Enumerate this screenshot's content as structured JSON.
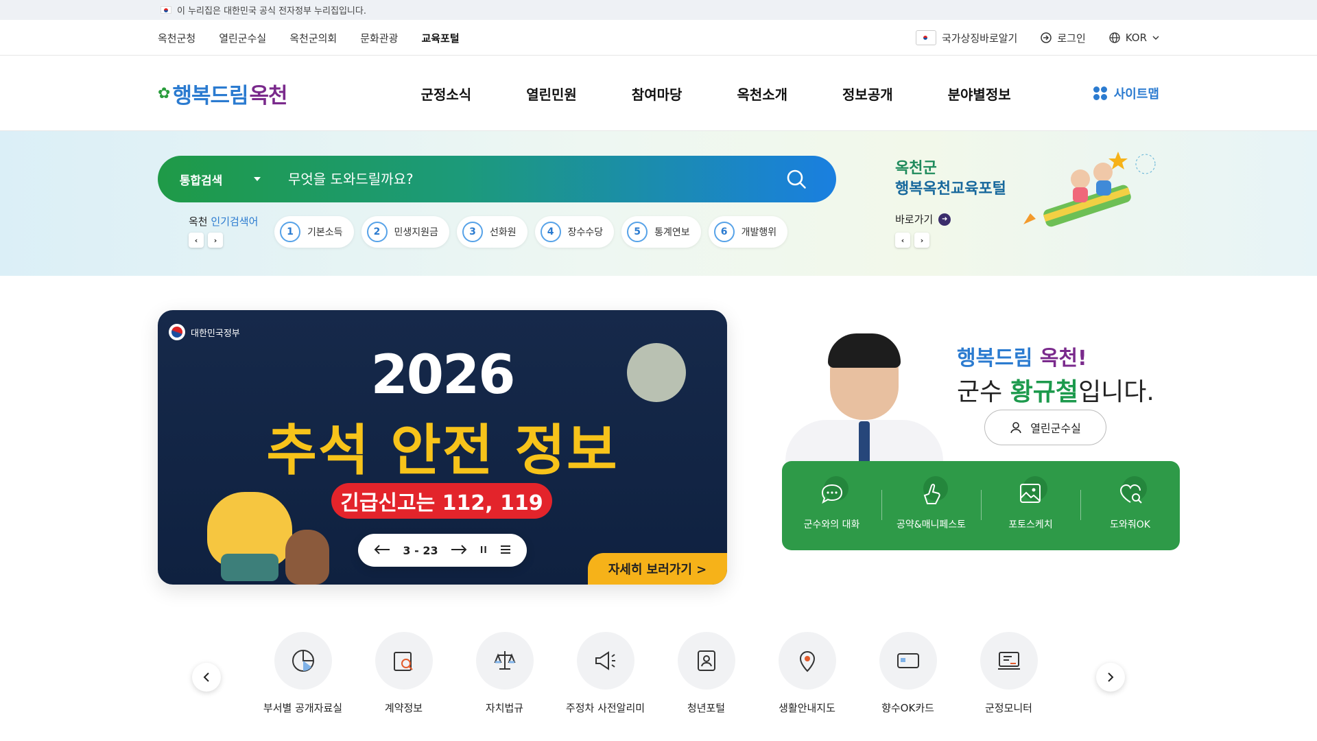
{
  "gov_notice": "이 누리집은 대한민국 공식 전자정부 누리집입니다.",
  "util": {
    "links": [
      "옥천군청",
      "열린군수실",
      "옥천군의회",
      "문화관광",
      "교육포털"
    ],
    "national_symbol": "국가상징바로알기",
    "login": "로그인",
    "lang": "KOR"
  },
  "header": {
    "logo_part1": "행복드림",
    "logo_part2": "옥천",
    "nav": [
      "군정소식",
      "열린민원",
      "참여마당",
      "옥천소개",
      "정보공개",
      "분야별정보"
    ],
    "sitemap": "사이트맵"
  },
  "search": {
    "scope": "통합검색",
    "placeholder": "무엇을 도와드릴까요?",
    "popular_prefix": "옥천",
    "popular_label": "인기검색어",
    "keywords": [
      {
        "num": "1",
        "text": "기본소득"
      },
      {
        "num": "2",
        "text": "민생지원금"
      },
      {
        "num": "3",
        "text": "선화원"
      },
      {
        "num": "4",
        "text": "장수수당"
      },
      {
        "num": "5",
        "text": "통계연보"
      },
      {
        "num": "6",
        "text": "개발행위"
      }
    ]
  },
  "promo": {
    "line1": "옥천군",
    "line2": "행복옥천교육포털",
    "goto": "바로가기"
  },
  "banner": {
    "gov_label": "대한민국정부",
    "year": "2026",
    "title": "추석 안전 정보",
    "emergency": "긴급신고는 112, 119",
    "detail": "자세히 보러가기 >",
    "pager": "3 - 23"
  },
  "mayor": {
    "greet_a": "행복드림 ",
    "greet_b": "옥천!",
    "greet_c": "군수 ",
    "greet_name": "황규철",
    "greet_d": "입니다.",
    "office_btn": "열린군수실",
    "links": [
      "군수와의 대화",
      "공약&매니페스토",
      "포토스케치",
      "도와줘OK"
    ]
  },
  "quick": [
    {
      "label": "부서별 공개자료실",
      "icon": "pie-chart-icon"
    },
    {
      "label": "계약정보",
      "icon": "contract-search-icon"
    },
    {
      "label": "자치법규",
      "icon": "scales-icon"
    },
    {
      "label": "주정차 사전알리미",
      "icon": "megaphone-icon"
    },
    {
      "label": "청년포털",
      "icon": "id-card-icon"
    },
    {
      "label": "생활안내지도",
      "icon": "map-pin-icon"
    },
    {
      "label": "향수OK카드",
      "icon": "card-icon"
    },
    {
      "label": "군정모니터",
      "icon": "monitor-icon"
    }
  ]
}
